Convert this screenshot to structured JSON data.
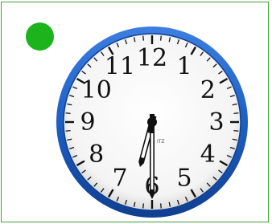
{
  "indicator": {
    "color": "#1db31d"
  },
  "clock": {
    "numerals": [
      "12",
      "1",
      "2",
      "3",
      "4",
      "5",
      "6",
      "7",
      "8",
      "9",
      "10",
      "11"
    ],
    "brand_text": "ITZ",
    "time": {
      "hour": 6,
      "minute": 30
    },
    "colors": {
      "rim": "#1d5fc4",
      "rim_dark": "#0f3f8f",
      "face": "#ffffff",
      "ticks": "#111111",
      "hands": "#111111",
      "card_border": "#3fa03a"
    }
  }
}
